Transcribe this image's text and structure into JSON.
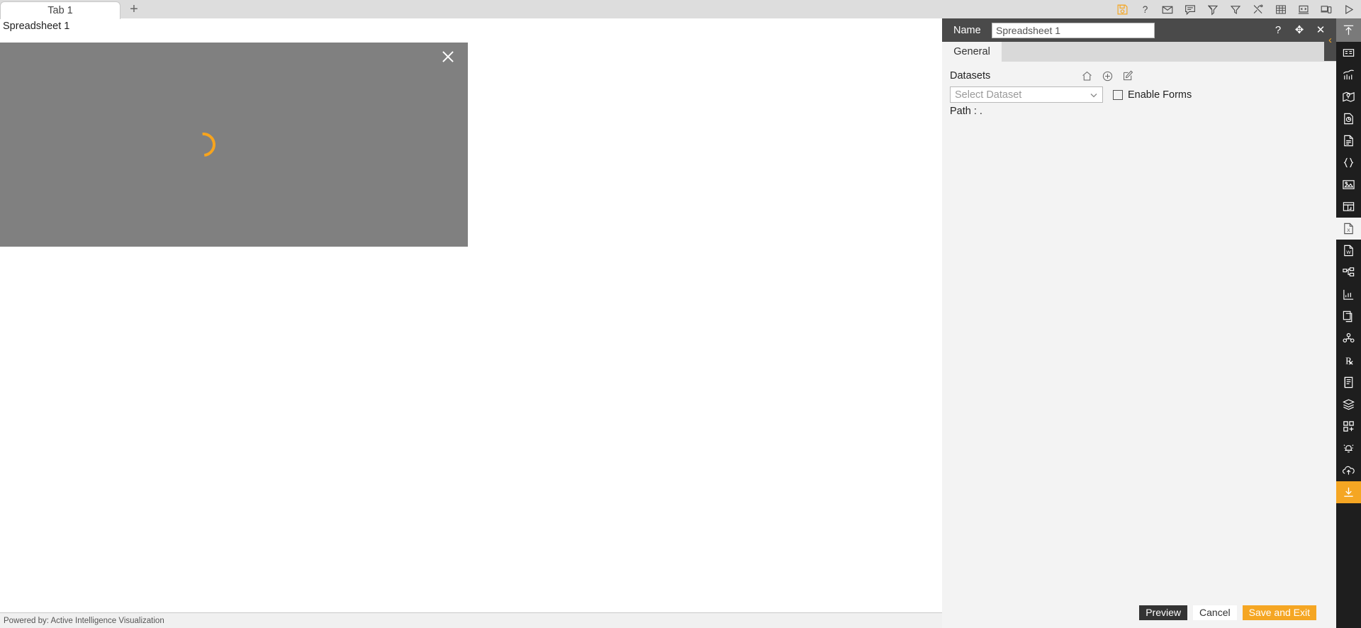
{
  "top_bar": {
    "tabs": [
      {
        "label": "Tab 1"
      }
    ],
    "new_tab_label": "+",
    "toolbar_icons": [
      {
        "name": "save-icon",
        "title": "Save"
      },
      {
        "name": "help-icon",
        "title": "Help"
      },
      {
        "name": "mail-icon",
        "title": "Mail"
      },
      {
        "name": "comment-icon",
        "title": "Comment"
      },
      {
        "name": "clear-filter-icon",
        "title": "Clear Filter"
      },
      {
        "name": "filter-icon",
        "title": "Filter"
      },
      {
        "name": "tools-icon",
        "title": "Tools"
      },
      {
        "name": "table-icon",
        "title": "Table"
      },
      {
        "name": "code-icon",
        "title": "Code"
      },
      {
        "name": "devices-icon",
        "title": "Devices"
      },
      {
        "name": "play-icon",
        "title": "Run"
      }
    ]
  },
  "canvas": {
    "sheet_title": "Spreadsheet 1",
    "loading_overlay": {
      "close_label": "×",
      "spinner_color": "#f7a41d",
      "background_color": "#808080"
    }
  },
  "status_bar": {
    "powered_by": "Powered by: Active Intelligence Visualization"
  },
  "properties_panel": {
    "header": {
      "name_label": "Name",
      "name_value": "Spreadsheet 1",
      "name_placeholder": "Spreadsheet 1",
      "help_label": "?",
      "move_label": "✥",
      "close_label": "✕"
    },
    "tabs": [
      {
        "label": "General",
        "active": true
      }
    ],
    "general": {
      "datasets_label": "Datasets",
      "dataset_icons": [
        {
          "name": "home-icon",
          "title": "Home"
        },
        {
          "name": "add-circle-icon",
          "title": "Add Dataset"
        },
        {
          "name": "edit-icon",
          "title": "Edit Dataset"
        }
      ],
      "dataset_select_placeholder": "Select Dataset",
      "dataset_select_value": "",
      "enable_forms_label": "Enable Forms",
      "enable_forms_checked": false,
      "path_label": "Path : ."
    },
    "footer": {
      "preview_label": "Preview",
      "cancel_label": "Cancel",
      "save_exit_label": "Save and Exit"
    },
    "collapse_arrow_label": "‹"
  },
  "right_sidebar": {
    "items": [
      {
        "name": "sidebar-collapse-up-icon",
        "label": "Collapse",
        "state": "top-active"
      },
      {
        "name": "sidebar-form-icon",
        "label": "Form",
        "state": ""
      },
      {
        "name": "sidebar-chart-icon",
        "label": "Chart",
        "state": ""
      },
      {
        "name": "sidebar-map-icon",
        "label": "Map",
        "state": ""
      },
      {
        "name": "sidebar-gauge-icon",
        "label": "Gauge",
        "state": ""
      },
      {
        "name": "sidebar-document-icon",
        "label": "Document",
        "state": ""
      },
      {
        "name": "sidebar-json-icon",
        "label": "JSON",
        "state": ""
      },
      {
        "name": "sidebar-image-icon",
        "label": "Image",
        "state": ""
      },
      {
        "name": "sidebar-panel-icon",
        "label": "Panel",
        "state": ""
      },
      {
        "name": "sidebar-excel-icon",
        "label": "Excel",
        "state": "sel-white"
      },
      {
        "name": "sidebar-word-icon",
        "label": "Word",
        "state": ""
      },
      {
        "name": "sidebar-tree-icon",
        "label": "Tree",
        "state": ""
      },
      {
        "name": "sidebar-bar-chart-icon",
        "label": "Bar Chart",
        "state": ""
      },
      {
        "name": "sidebar-copy-icon",
        "label": "Copy",
        "state": ""
      },
      {
        "name": "sidebar-group-icon",
        "label": "Group",
        "state": ""
      },
      {
        "name": "sidebar-prescription-icon",
        "label": "Rx",
        "state": ""
      },
      {
        "name": "sidebar-report-icon",
        "label": "Report",
        "state": ""
      },
      {
        "name": "sidebar-layers-icon",
        "label": "Layers",
        "state": ""
      },
      {
        "name": "sidebar-add-widget-icon",
        "label": "Add Widget",
        "state": ""
      },
      {
        "name": "sidebar-alert-icon",
        "label": "Alert",
        "state": ""
      },
      {
        "name": "sidebar-cloud-upload-icon",
        "label": "Cloud Upload",
        "state": ""
      },
      {
        "name": "sidebar-download-icon",
        "label": "Download",
        "state": "sel-orange"
      }
    ]
  },
  "colors": {
    "accent_orange": "#f5a623",
    "panel_header_dark": "#4a4a4a",
    "sidebar_dark": "#1e1e1e",
    "panel_body": "#f3f3f3",
    "overlay_gray": "#808080"
  }
}
